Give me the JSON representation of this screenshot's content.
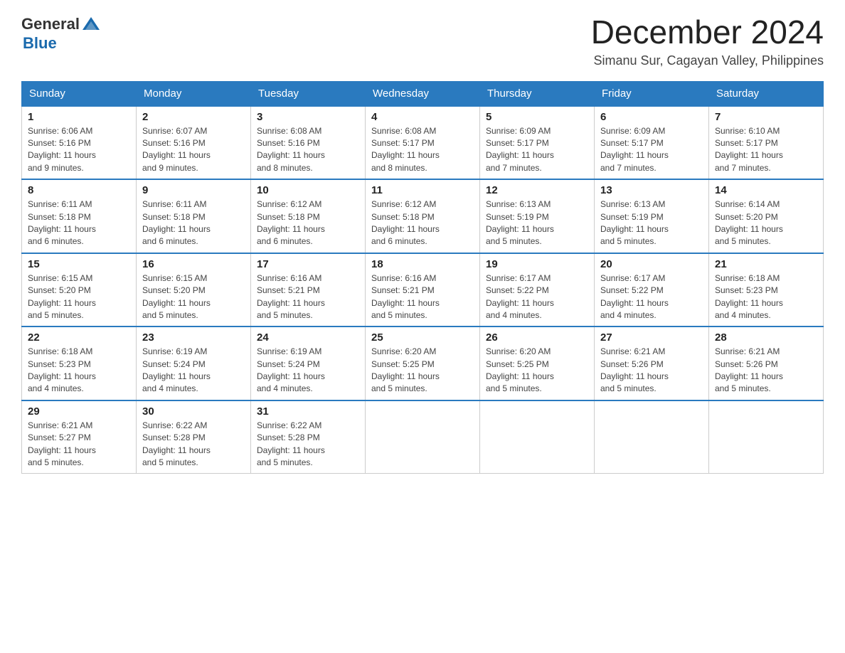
{
  "logo": {
    "general": "General",
    "blue": "Blue"
  },
  "title": "December 2024",
  "subtitle": "Simanu Sur, Cagayan Valley, Philippines",
  "days": [
    "Sunday",
    "Monday",
    "Tuesday",
    "Wednesday",
    "Thursday",
    "Friday",
    "Saturday"
  ],
  "weeks": [
    [
      {
        "num": "1",
        "sunrise": "6:06 AM",
        "sunset": "5:16 PM",
        "daylight": "11 hours and 9 minutes."
      },
      {
        "num": "2",
        "sunrise": "6:07 AM",
        "sunset": "5:16 PM",
        "daylight": "11 hours and 9 minutes."
      },
      {
        "num": "3",
        "sunrise": "6:08 AM",
        "sunset": "5:16 PM",
        "daylight": "11 hours and 8 minutes."
      },
      {
        "num": "4",
        "sunrise": "6:08 AM",
        "sunset": "5:17 PM",
        "daylight": "11 hours and 8 minutes."
      },
      {
        "num": "5",
        "sunrise": "6:09 AM",
        "sunset": "5:17 PM",
        "daylight": "11 hours and 7 minutes."
      },
      {
        "num": "6",
        "sunrise": "6:09 AM",
        "sunset": "5:17 PM",
        "daylight": "11 hours and 7 minutes."
      },
      {
        "num": "7",
        "sunrise": "6:10 AM",
        "sunset": "5:17 PM",
        "daylight": "11 hours and 7 minutes."
      }
    ],
    [
      {
        "num": "8",
        "sunrise": "6:11 AM",
        "sunset": "5:18 PM",
        "daylight": "11 hours and 6 minutes."
      },
      {
        "num": "9",
        "sunrise": "6:11 AM",
        "sunset": "5:18 PM",
        "daylight": "11 hours and 6 minutes."
      },
      {
        "num": "10",
        "sunrise": "6:12 AM",
        "sunset": "5:18 PM",
        "daylight": "11 hours and 6 minutes."
      },
      {
        "num": "11",
        "sunrise": "6:12 AM",
        "sunset": "5:18 PM",
        "daylight": "11 hours and 6 minutes."
      },
      {
        "num": "12",
        "sunrise": "6:13 AM",
        "sunset": "5:19 PM",
        "daylight": "11 hours and 5 minutes."
      },
      {
        "num": "13",
        "sunrise": "6:13 AM",
        "sunset": "5:19 PM",
        "daylight": "11 hours and 5 minutes."
      },
      {
        "num": "14",
        "sunrise": "6:14 AM",
        "sunset": "5:20 PM",
        "daylight": "11 hours and 5 minutes."
      }
    ],
    [
      {
        "num": "15",
        "sunrise": "6:15 AM",
        "sunset": "5:20 PM",
        "daylight": "11 hours and 5 minutes."
      },
      {
        "num": "16",
        "sunrise": "6:15 AM",
        "sunset": "5:20 PM",
        "daylight": "11 hours and 5 minutes."
      },
      {
        "num": "17",
        "sunrise": "6:16 AM",
        "sunset": "5:21 PM",
        "daylight": "11 hours and 5 minutes."
      },
      {
        "num": "18",
        "sunrise": "6:16 AM",
        "sunset": "5:21 PM",
        "daylight": "11 hours and 5 minutes."
      },
      {
        "num": "19",
        "sunrise": "6:17 AM",
        "sunset": "5:22 PM",
        "daylight": "11 hours and 4 minutes."
      },
      {
        "num": "20",
        "sunrise": "6:17 AM",
        "sunset": "5:22 PM",
        "daylight": "11 hours and 4 minutes."
      },
      {
        "num": "21",
        "sunrise": "6:18 AM",
        "sunset": "5:23 PM",
        "daylight": "11 hours and 4 minutes."
      }
    ],
    [
      {
        "num": "22",
        "sunrise": "6:18 AM",
        "sunset": "5:23 PM",
        "daylight": "11 hours and 4 minutes."
      },
      {
        "num": "23",
        "sunrise": "6:19 AM",
        "sunset": "5:24 PM",
        "daylight": "11 hours and 4 minutes."
      },
      {
        "num": "24",
        "sunrise": "6:19 AM",
        "sunset": "5:24 PM",
        "daylight": "11 hours and 4 minutes."
      },
      {
        "num": "25",
        "sunrise": "6:20 AM",
        "sunset": "5:25 PM",
        "daylight": "11 hours and 5 minutes."
      },
      {
        "num": "26",
        "sunrise": "6:20 AM",
        "sunset": "5:25 PM",
        "daylight": "11 hours and 5 minutes."
      },
      {
        "num": "27",
        "sunrise": "6:21 AM",
        "sunset": "5:26 PM",
        "daylight": "11 hours and 5 minutes."
      },
      {
        "num": "28",
        "sunrise": "6:21 AM",
        "sunset": "5:26 PM",
        "daylight": "11 hours and 5 minutes."
      }
    ],
    [
      {
        "num": "29",
        "sunrise": "6:21 AM",
        "sunset": "5:27 PM",
        "daylight": "11 hours and 5 minutes."
      },
      {
        "num": "30",
        "sunrise": "6:22 AM",
        "sunset": "5:28 PM",
        "daylight": "11 hours and 5 minutes."
      },
      {
        "num": "31",
        "sunrise": "6:22 AM",
        "sunset": "5:28 PM",
        "daylight": "11 hours and 5 minutes."
      },
      null,
      null,
      null,
      null
    ]
  ],
  "labels": {
    "sunrise": "Sunrise:",
    "sunset": "Sunset:",
    "daylight": "Daylight:"
  }
}
